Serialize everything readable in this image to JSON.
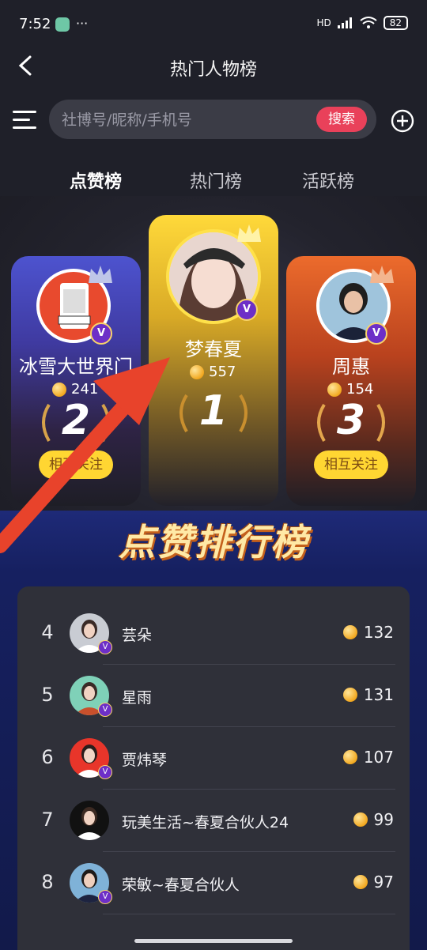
{
  "status": {
    "time": "7:52",
    "dots": "···",
    "network": "HD",
    "battery": "82"
  },
  "header": {
    "title": "热门人物榜"
  },
  "search": {
    "placeholder": "社博号/昵称/手机号",
    "button": "搜索"
  },
  "tabs": [
    {
      "label": "点赞榜",
      "active": true
    },
    {
      "label": "热门榜",
      "active": false
    },
    {
      "label": "活跃榜",
      "active": false
    }
  ],
  "podium": {
    "first": {
      "rank": "1",
      "name": "梦春夏",
      "likes": "557"
    },
    "second": {
      "rank": "2",
      "name": "冰雪大世界门",
      "likes": "241",
      "button": "相互关注"
    },
    "third": {
      "rank": "3",
      "name": "周惠",
      "likes": "154",
      "button": "相互关注"
    }
  },
  "banner": {
    "title": "点赞排行榜"
  },
  "list": [
    {
      "rank": "4",
      "name": "芸朵",
      "score": "132"
    },
    {
      "rank": "5",
      "name": "星雨",
      "score": "131"
    },
    {
      "rank": "6",
      "name": "贾炜琴",
      "score": "107"
    },
    {
      "rank": "7",
      "name": "玩美生活~春夏合伙人24",
      "score": "99"
    },
    {
      "rank": "8",
      "name": "荣敏~春夏合伙人",
      "score": "97"
    }
  ],
  "colors": {
    "accent": "#e9415a",
    "gold": "#ffd632",
    "purple": "#6d2fc7"
  }
}
